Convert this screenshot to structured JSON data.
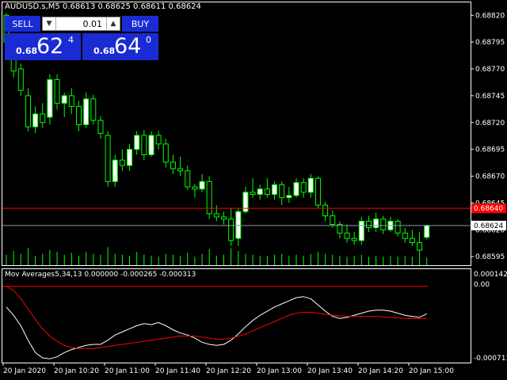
{
  "header": {
    "symbol_line": "AUDUSD.s,M5  0.68613 0.68625 0.68611 0.68624"
  },
  "trade_panel": {
    "sell_label": "SELL",
    "buy_label": "BUY",
    "lot_value": "0.01",
    "sell_price": {
      "prefix": "0.68",
      "big": "62",
      "sup": "4"
    },
    "buy_price": {
      "prefix": "0.68",
      "big": "64",
      "sup": "0"
    },
    "button_color": "#1a2bd4"
  },
  "price_axis": {
    "ticks": [
      "0.68820",
      "0.68795",
      "0.68770",
      "0.68745",
      "0.68720",
      "0.68695",
      "0.68670",
      "0.68645",
      "0.68620",
      "0.68595"
    ],
    "ask_label": "0.68640",
    "bid_label": "0.68624",
    "ask_color": "#ff0000",
    "bid_color": "#ffffff"
  },
  "indicator": {
    "label": "Mov Averages5,34,13 0.000000 -0.000265 -0.000313",
    "ticks": [
      "0.000142",
      "0.00",
      "-0.000713"
    ],
    "fast_color": "#ffffff",
    "slow_color": "#ff0000"
  },
  "time_axis": {
    "labels": [
      "20 Jan 2020",
      "20 Jan 10:20",
      "20 Jan 11:00",
      "20 Jan 11:40",
      "20 Jan 12:20",
      "20 Jan 13:00",
      "20 Jan 13:40",
      "20 Jan 14:20",
      "20 Jan 15:00"
    ]
  },
  "colors": {
    "bull": "#ffffff",
    "bear": "#000000",
    "candle_outline": "#00ff00",
    "volume": "#00ff00"
  },
  "chart_data": {
    "type": "candlestick",
    "candles": [
      [
        0.6882,
        0.68822,
        0.6879,
        0.68795
      ],
      [
        0.68795,
        0.688,
        0.68762,
        0.68768
      ],
      [
        0.6877,
        0.68775,
        0.68745,
        0.6875
      ],
      [
        0.68745,
        0.68752,
        0.68712,
        0.68716
      ],
      [
        0.68716,
        0.68735,
        0.6871,
        0.68728
      ],
      [
        0.68728,
        0.68738,
        0.68715,
        0.6872
      ],
      [
        0.68725,
        0.68765,
        0.68718,
        0.6876
      ],
      [
        0.6876,
        0.68765,
        0.68732,
        0.68738
      ],
      [
        0.68738,
        0.68748,
        0.68725,
        0.68745
      ],
      [
        0.68745,
        0.68752,
        0.68728,
        0.68735
      ],
      [
        0.68735,
        0.6874,
        0.68712,
        0.68718
      ],
      [
        0.68718,
        0.68748,
        0.68715,
        0.68742
      ],
      [
        0.68742,
        0.68746,
        0.68718,
        0.68722
      ],
      [
        0.68722,
        0.68726,
        0.68705,
        0.6871
      ],
      [
        0.68708,
        0.68712,
        0.6866,
        0.68665
      ],
      [
        0.68665,
        0.6869,
        0.6866,
        0.68685
      ],
      [
        0.68685,
        0.68695,
        0.68675,
        0.6868
      ],
      [
        0.6868,
        0.687,
        0.68675,
        0.68695
      ],
      [
        0.68695,
        0.68712,
        0.6869,
        0.68708
      ],
      [
        0.68708,
        0.68713,
        0.68685,
        0.6869
      ],
      [
        0.6869,
        0.68712,
        0.68688,
        0.68708
      ],
      [
        0.68708,
        0.68712,
        0.68695,
        0.687
      ],
      [
        0.687,
        0.68705,
        0.68678,
        0.68683
      ],
      [
        0.68683,
        0.6869,
        0.68672,
        0.68677
      ],
      [
        0.68677,
        0.68688,
        0.6867,
        0.68675
      ],
      [
        0.68675,
        0.6868,
        0.68657,
        0.6866
      ],
      [
        0.6866,
        0.68663,
        0.6865,
        0.68658
      ],
      [
        0.68658,
        0.68672,
        0.68655,
        0.68665
      ],
      [
        0.68665,
        0.6867,
        0.6863,
        0.68635
      ],
      [
        0.68635,
        0.68643,
        0.68628,
        0.68632
      ],
      [
        0.68632,
        0.68637,
        0.68625,
        0.6863
      ],
      [
        0.6863,
        0.6864,
        0.68605,
        0.6861
      ],
      [
        0.68612,
        0.6864,
        0.68605,
        0.68637
      ],
      [
        0.68637,
        0.6866,
        0.68635,
        0.68655
      ],
      [
        0.68655,
        0.68668,
        0.6865,
        0.68653
      ],
      [
        0.68653,
        0.68662,
        0.68648,
        0.68658
      ],
      [
        0.68658,
        0.68668,
        0.6865,
        0.68653
      ],
      [
        0.68653,
        0.68665,
        0.68648,
        0.68662
      ],
      [
        0.68662,
        0.68665,
        0.68643,
        0.6865
      ],
      [
        0.6865,
        0.6866,
        0.68645,
        0.68652
      ],
      [
        0.68652,
        0.68668,
        0.6865,
        0.68664
      ],
      [
        0.68664,
        0.68668,
        0.6865,
        0.68655
      ],
      [
        0.68655,
        0.68672,
        0.6865,
        0.68668
      ],
      [
        0.68668,
        0.6867,
        0.6864,
        0.68643
      ],
      [
        0.68643,
        0.68646,
        0.68628,
        0.68633
      ],
      [
        0.68633,
        0.68638,
        0.68622,
        0.68625
      ],
      [
        0.68625,
        0.68628,
        0.68612,
        0.68617
      ],
      [
        0.68617,
        0.68625,
        0.68608,
        0.68612
      ],
      [
        0.68612,
        0.68618,
        0.68606,
        0.6861
      ],
      [
        0.6861,
        0.68632,
        0.68606,
        0.68628
      ],
      [
        0.68628,
        0.68633,
        0.68618,
        0.68622
      ],
      [
        0.68622,
        0.68636,
        0.68618,
        0.6863
      ],
      [
        0.6863,
        0.68633,
        0.68616,
        0.6862
      ],
      [
        0.6862,
        0.68632,
        0.68618,
        0.68628
      ],
      [
        0.68628,
        0.6863,
        0.68614,
        0.68617
      ],
      [
        0.68617,
        0.68622,
        0.68608,
        0.68612
      ],
      [
        0.68612,
        0.6862,
        0.68605,
        0.68608
      ],
      [
        0.68608,
        0.68618,
        0.68596,
        0.68601
      ],
      [
        0.68613,
        0.68625,
        0.68611,
        0.68624
      ]
    ],
    "volumes": [
      0.55,
      0.75,
      0.6,
      0.9,
      0.5,
      0.6,
      0.8,
      0.7,
      0.55,
      0.65,
      0.5,
      0.7,
      0.6,
      0.55,
      0.95,
      0.6,
      0.55,
      0.5,
      0.7,
      0.55,
      0.5,
      0.45,
      0.6,
      0.55,
      0.5,
      0.65,
      0.45,
      0.6,
      0.85,
      0.5,
      0.55,
      0.9,
      0.75,
      0.6,
      0.55,
      0.5,
      0.5,
      0.55,
      0.6,
      0.5,
      0.55,
      0.5,
      0.6,
      0.7,
      0.6,
      0.55,
      0.5,
      0.45,
      0.5,
      0.55,
      0.45,
      0.5,
      0.45,
      0.5,
      0.45,
      0.5,
      0.45,
      0.6,
      0.4
    ],
    "indicator_fast": [
      -0.0002,
      -0.00028,
      -0.00038,
      -0.00052,
      -0.00064,
      -0.00069,
      -0.0007,
      -0.00068,
      -0.00064,
      -0.00061,
      -0.00059,
      -0.00057,
      -0.00056,
      -0.00056,
      -0.00052,
      -0.00047,
      -0.00044,
      -0.00041,
      -0.00038,
      -0.00036,
      -0.00037,
      -0.00035,
      -0.00038,
      -0.00042,
      -0.00045,
      -0.00047,
      -0.0005,
      -0.00054,
      -0.00056,
      -0.00057,
      -0.00056,
      -0.00052,
      -0.00046,
      -0.00039,
      -0.00033,
      -0.00028,
      -0.00024,
      -0.0002,
      -0.00017,
      -0.00014,
      -0.00011,
      -0.0001,
      -0.00012,
      -0.00018,
      -0.00024,
      -0.00029,
      -0.00031,
      -0.0003,
      -0.00028,
      -0.00026,
      -0.00024,
      -0.00023,
      -0.00023,
      -0.00024,
      -0.00026,
      -0.00028,
      -0.00029,
      -0.0003,
      -0.000265
    ],
    "indicator_slow": [
      0.0,
      -4e-05,
      -0.00012,
      -0.00022,
      -0.00032,
      -0.00041,
      -0.00048,
      -0.00053,
      -0.00057,
      -0.00059,
      -0.0006,
      -0.0006,
      -0.0006,
      -0.00059,
      -0.00058,
      -0.00057,
      -0.00056,
      -0.00055,
      -0.00054,
      -0.00053,
      -0.00052,
      -0.00051,
      -0.0005,
      -0.00049,
      -0.00048,
      -0.00048,
      -0.00048,
      -0.00049,
      -0.0005,
      -0.00051,
      -0.00051,
      -0.0005,
      -0.00048,
      -0.00046,
      -0.00043,
      -0.0004,
      -0.00037,
      -0.00034,
      -0.00031,
      -0.00028,
      -0.00026,
      -0.00025,
      -0.00025,
      -0.00026,
      -0.00027,
      -0.00028,
      -0.000285,
      -0.00029,
      -0.00029,
      -0.00029,
      -0.00029,
      -0.00029,
      -0.000295,
      -0.0003,
      -0.000305,
      -0.00031,
      -0.000312,
      -0.000313,
      -0.000313
    ],
    "price_range": [
      0.68587,
      0.68832
    ],
    "indicator_range": [
      -0.000713,
      0.000142
    ]
  }
}
